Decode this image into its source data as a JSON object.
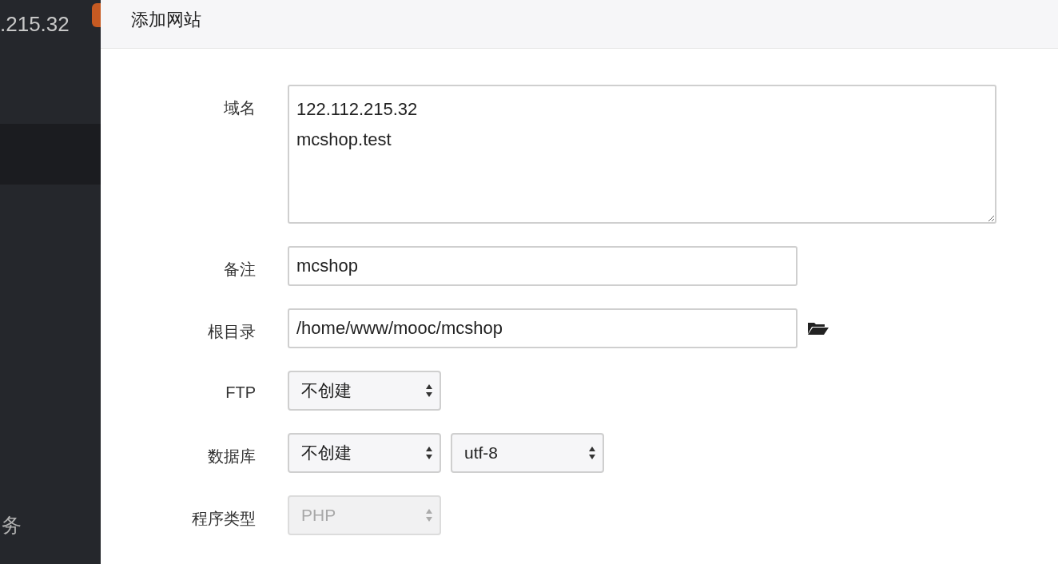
{
  "sidebar": {
    "host": ".215.32",
    "items": [
      {
        "selected": true
      },
      {
        "label": "务",
        "selected": false
      }
    ]
  },
  "dialog": {
    "title": "添加网站",
    "rows": [
      {
        "kind": "textarea",
        "label": "域名",
        "lines": [
          "122.112.215.32",
          "mcshop.test"
        ]
      },
      {
        "kind": "input",
        "label": "备注",
        "value": "mcshop"
      },
      {
        "kind": "path",
        "label": "根目录",
        "value": "/home/www/mooc/mcshop"
      },
      {
        "kind": "selects",
        "label": "FTP",
        "selects": [
          {
            "value": "不创建",
            "disabled": false
          }
        ]
      },
      {
        "kind": "selects",
        "label": "数据库",
        "selects": [
          {
            "value": "不创建",
            "disabled": false
          },
          {
            "value": "utf-8",
            "disabled": false
          }
        ]
      },
      {
        "kind": "selects",
        "label": "程序类型",
        "selects": [
          {
            "value": "PHP",
            "disabled": true
          }
        ]
      }
    ]
  }
}
